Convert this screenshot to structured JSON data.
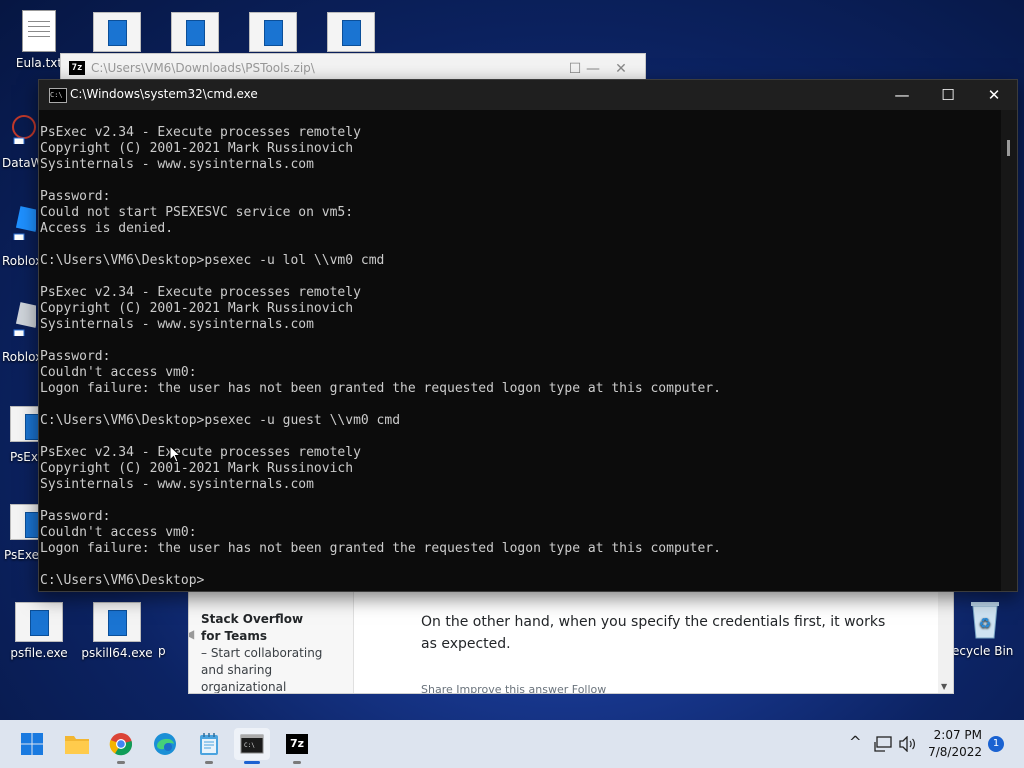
{
  "desktop": {
    "top_icons": [
      "Eula.txt",
      "",
      "",
      "",
      ""
    ],
    "left_labels": [
      "DataW",
      "Roblox",
      "Roblox",
      "PsExe",
      "PsExe"
    ],
    "bottom_icons": [
      "psfile.exe",
      "pskill64.exe",
      "p"
    ],
    "recycle_bin": "ecycle Bin"
  },
  "zip_window": {
    "title": "C:\\Users\\VM6\\Downloads\\PSTools.zip\\",
    "icon_text": "7z"
  },
  "browser_behind": {
    "promo_title": "Stack Overflow for Teams",
    "promo_body": "– Start collaborating and sharing organizational knowledge.",
    "answer_text": "On the other hand, when you specify the credentials first, it works as expected.",
    "footer": "Share  Improve this answer  Follow"
  },
  "cmd_window": {
    "title": "C:\\Windows\\system32\\cmd.exe",
    "minimize": "—",
    "maximize": "☐",
    "close": "✕",
    "lines": [
      "PsExec v2.34 - Execute processes remotely",
      "Copyright (C) 2001-2021 Mark Russinovich",
      "Sysinternals - www.sysinternals.com",
      "",
      "Password:",
      "Could not start PSEXESVC service on vm5:",
      "Access is denied.",
      "",
      "C:\\Users\\VM6\\Desktop>psexec -u lol \\\\vm0 cmd",
      "",
      "PsExec v2.34 - Execute processes remotely",
      "Copyright (C) 2001-2021 Mark Russinovich",
      "Sysinternals - www.sysinternals.com",
      "",
      "Password:",
      "Couldn't access vm0:",
      "Logon failure: the user has not been granted the requested logon type at this computer.",
      "",
      "C:\\Users\\VM6\\Desktop>psexec -u guest \\\\vm0 cmd",
      "",
      "PsExec v2.34 - Execute processes remotely",
      "Copyright (C) 2001-2021 Mark Russinovich",
      "Sysinternals - www.sysinternals.com",
      "",
      "Password:",
      "Couldn't access vm0:",
      "Logon failure: the user has not been granted the requested logon type at this computer.",
      "",
      "C:\\Users\\VM6\\Desktop>"
    ]
  },
  "taskbar": {
    "apps": [
      "start-icon",
      "file-explorer-icon",
      "chrome-icon",
      "edge-icon",
      "notepad-icon",
      "cmd-icon",
      "7zip-icon"
    ],
    "time": "2:07 PM",
    "date": "7/8/2022",
    "notification_count": "1",
    "tray_chevron": "^",
    "tray_icons": [
      "network-icon",
      "volume-icon"
    ],
    "sevenzip_label": "7z"
  }
}
